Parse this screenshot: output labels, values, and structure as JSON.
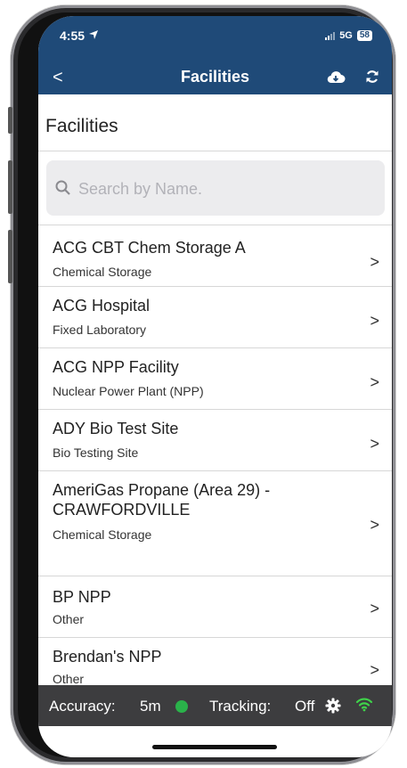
{
  "status": {
    "time": "4:55",
    "network": "5G",
    "battery": "58"
  },
  "navbar": {
    "back": "<",
    "title": "Facilities"
  },
  "page": {
    "heading": "Facilities"
  },
  "search": {
    "placeholder": "Search by Name."
  },
  "facilities": [
    {
      "name": "ACG CBT Chem Storage A",
      "type": "Chemical Storage"
    },
    {
      "name": "ACG Hospital",
      "type": "Fixed Laboratory"
    },
    {
      "name": "ACG NPP Facility",
      "type": "Nuclear Power Plant (NPP)"
    },
    {
      "name": "ADY Bio Test Site",
      "type": "Bio Testing Site"
    },
    {
      "name": "AmeriGas Propane (Area 29) - CRAWFORDVILLE",
      "type": "Chemical Storage"
    },
    {
      "name": "BP NPP",
      "type": "Other"
    },
    {
      "name": "Brendan's NPP",
      "type": "Other"
    }
  ],
  "chevron": ">",
  "bottom_bar": {
    "accuracy_label": "Accuracy:",
    "accuracy_value": "5m",
    "tracking_label": "Tracking:",
    "tracking_value": "Off"
  },
  "colors": {
    "header": "#1f4a78",
    "bottom_bar": "#3d3d3f",
    "status_ok": "#2ab24a"
  }
}
